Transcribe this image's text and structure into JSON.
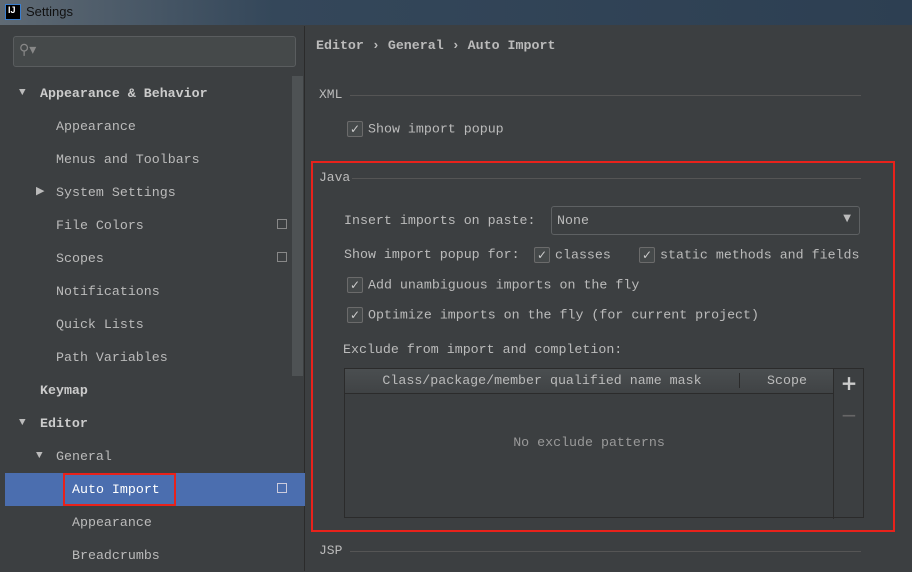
{
  "window": {
    "title": "Settings",
    "logo": "IJ"
  },
  "search": {
    "placeholder": ""
  },
  "sidebar": {
    "items": [
      {
        "label": "Appearance & Behavior"
      },
      {
        "label": "Appearance"
      },
      {
        "label": "Menus and Toolbars"
      },
      {
        "label": "System Settings"
      },
      {
        "label": "File Colors"
      },
      {
        "label": "Scopes"
      },
      {
        "label": "Notifications"
      },
      {
        "label": "Quick Lists"
      },
      {
        "label": "Path Variables"
      },
      {
        "label": "Keymap"
      },
      {
        "label": "Editor"
      },
      {
        "label": "General"
      },
      {
        "label": "Auto Import"
      },
      {
        "label": "Appearance"
      },
      {
        "label": "Breadcrumbs"
      }
    ]
  },
  "breadcrumb": {
    "a": "Editor",
    "b": "General",
    "c": "Auto Import",
    "sep": "›"
  },
  "xml": {
    "title": "XML",
    "show_popup": "Show import popup"
  },
  "java": {
    "title": "Java",
    "insert_label": "Insert imports on paste:",
    "insert_value": "None",
    "popup_for": "Show import popup for:",
    "classes": "classes",
    "static": "static methods and fields",
    "unambiguous": "Add unambiguous imports on the fly",
    "optimize": "Optimize imports on the fly (for current project)",
    "exclude_label": "Exclude from import and completion:",
    "col1": "Class/package/member qualified name mask",
    "col2": "Scope",
    "empty": "No exclude patterns",
    "add": "+",
    "remove": "−"
  },
  "jsp": {
    "title": "JSP"
  },
  "colors": {
    "accent": "#4b6eaf",
    "highlight": "#e8221b"
  }
}
